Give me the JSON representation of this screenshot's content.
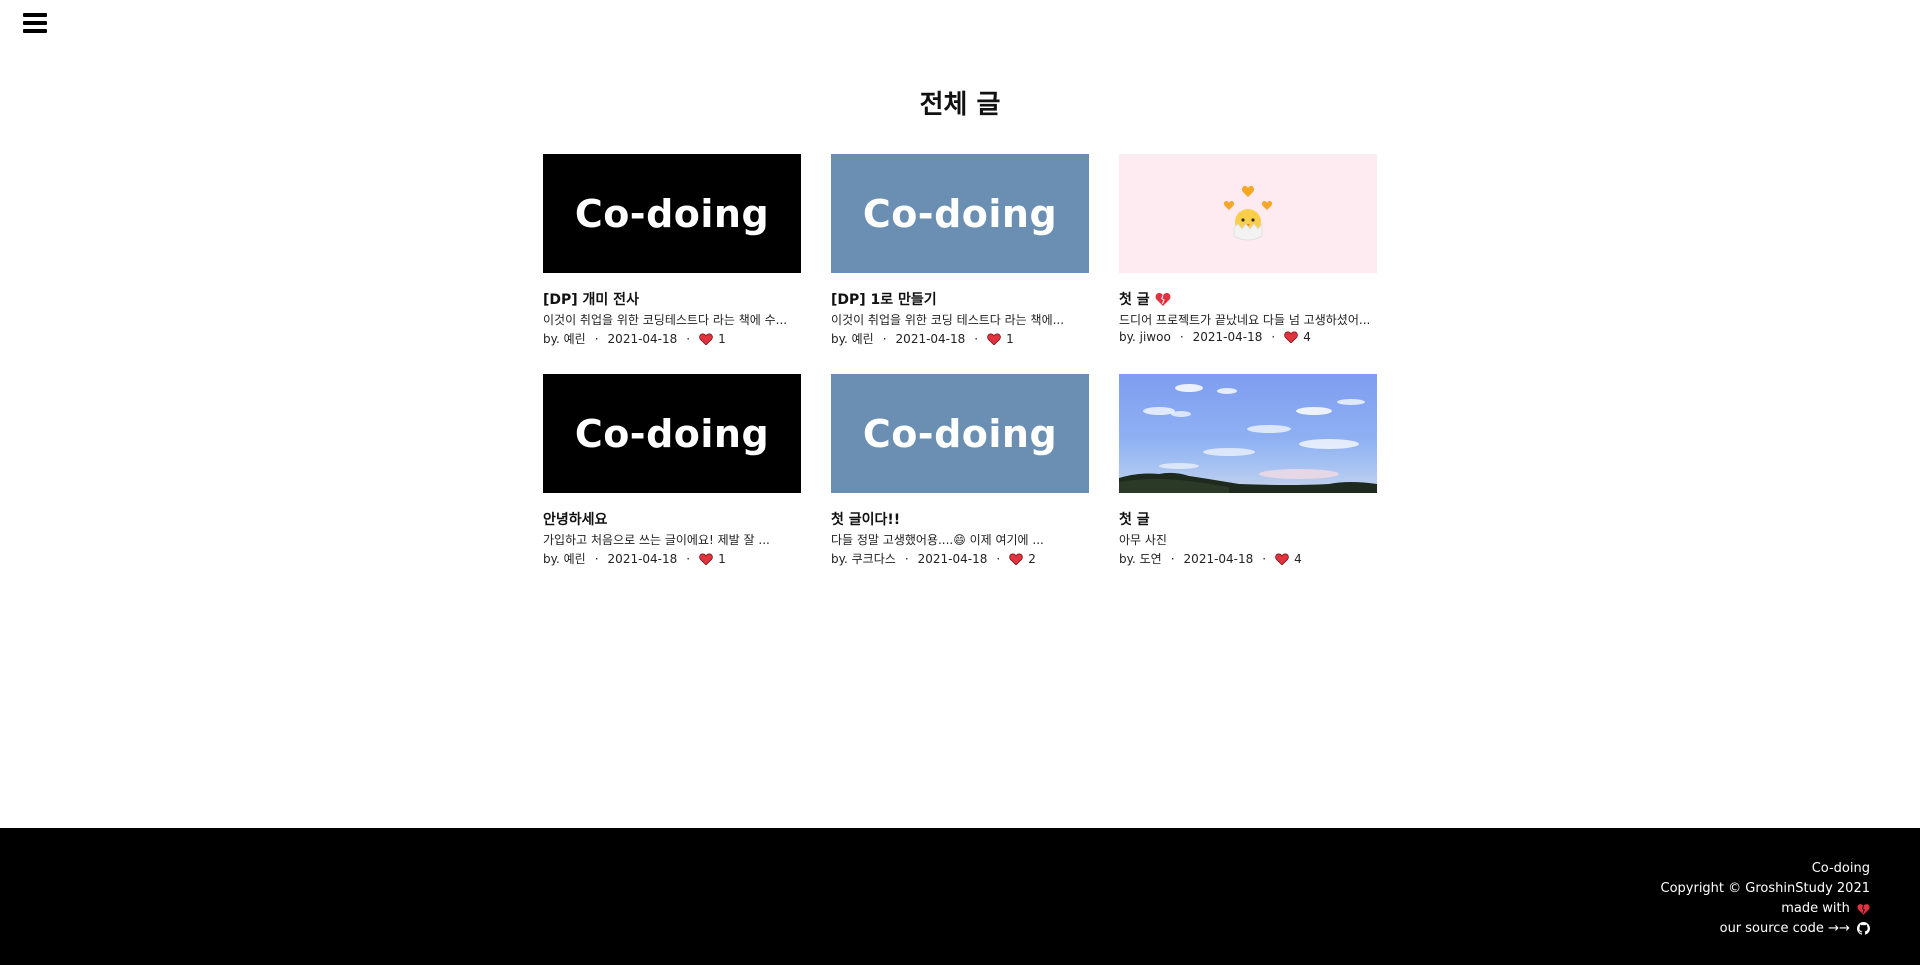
{
  "page": {
    "title": "전체 글"
  },
  "posts": [
    {
      "thumb_text": "Co-doing",
      "thumb_style": "black",
      "title": "[DP] 개미 전사",
      "excerpt": "이것이 취업을 위한 코딩테스트다 라는 책에 수...",
      "author": "by. 예린",
      "date": "2021-04-18",
      "likes": "1"
    },
    {
      "thumb_text": "Co-doing",
      "thumb_style": "blue",
      "title": "[DP] 1로 만들기",
      "excerpt": "이것이 취업을 위한 코딩 테스트다 라는 책에...",
      "author": "by. 예린",
      "date": "2021-04-18",
      "likes": "1"
    },
    {
      "thumb_text": "",
      "thumb_style": "pink",
      "title": "첫 글",
      "excerpt": "드디어 프로젝트가 끝났네요 다들 넘 고생하셨어...",
      "author": "by. jiwoo",
      "date": "2021-04-18",
      "likes": "4"
    },
    {
      "thumb_text": "Co-doing",
      "thumb_style": "black",
      "title": "안녕하세요",
      "excerpt": "가입하고 처음으로 쓰는 글이에요! 제발 잘 ...",
      "author": "by. 예린",
      "date": "2021-04-18",
      "likes": "1"
    },
    {
      "thumb_text": "Co-doing",
      "thumb_style": "blue",
      "title": "첫 글이다!!",
      "excerpt": "다들 정말 고생했어용....😄 이제 여기에 ...",
      "author": "by. 쿠크다스",
      "date": "2021-04-18",
      "likes": "2"
    },
    {
      "thumb_text": "",
      "thumb_style": "sky",
      "title": "첫 글",
      "excerpt": "아무 사진",
      "author": "by. 도연",
      "date": "2021-04-18",
      "likes": "4"
    }
  ],
  "footer": {
    "brand": "Co-doing",
    "copyright": "Copyright © GroshinStudy 2021",
    "made_with": "made with",
    "source": "our source code →→"
  },
  "icons": {
    "menu": "hamburger-menu-icon",
    "heart": "heart-icon",
    "github": "github-icon",
    "chick": "chick-with-hearts-icon"
  },
  "colors": {
    "heart": "#e0323f",
    "footer_bg": "#000000",
    "thumb_blue": "#6a8fb3",
    "thumb_pink": "#fdebf1"
  }
}
